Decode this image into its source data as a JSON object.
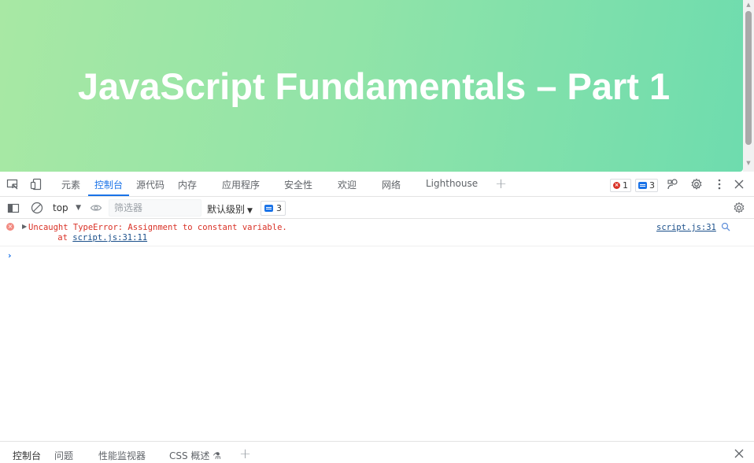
{
  "page": {
    "hero_title": "JavaScript Fundamentals – Part 1",
    "hero_gradient": [
      "#a8e8a4",
      "#6edcae"
    ]
  },
  "devtools": {
    "tabs": [
      "元素",
      "控制台",
      "源代码",
      "内存",
      "应用程序",
      "安全性",
      "欢迎",
      "网络",
      "Lighthouse"
    ],
    "active_tab": "控制台",
    "error_count": "1",
    "message_count": "3",
    "filterbar": {
      "context": "top",
      "filter_placeholder": "筛选器",
      "levels": "默认级别",
      "issues_count": "3"
    },
    "console": {
      "error_message": "Uncaught TypeError: Assignment to constant variable.",
      "stack_prefix": "    at ",
      "stack_link": "script.js:31:11",
      "source_link": "script.js:31"
    },
    "drawer_tabs": [
      "控制台",
      "问题",
      "性能监视器",
      "CSS 概述"
    ]
  },
  "colors": {
    "accent": "#1a73e8",
    "error": "#d93025"
  }
}
